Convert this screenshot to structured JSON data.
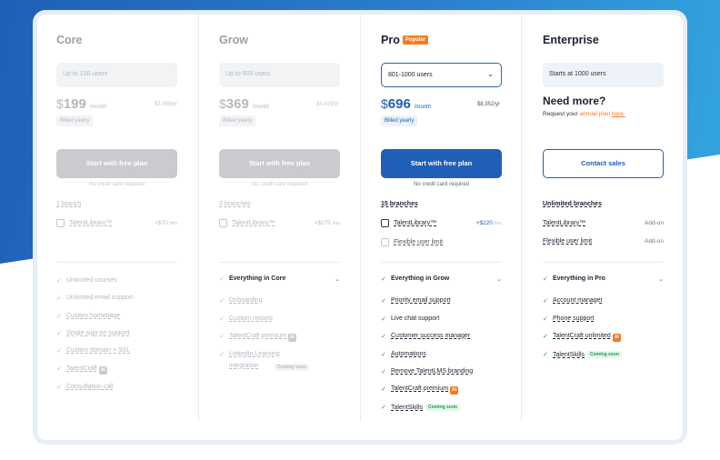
{
  "plans": [
    {
      "name": "Core",
      "users": "Up to 100 users",
      "currency": "$",
      "price": "199",
      "per": "/month",
      "yearly": "$2,388/yr",
      "billed": "Billed yearly",
      "cta": "Start with free plan",
      "no_cc": "No credit card required",
      "branches": "1 branch",
      "addons": [
        {
          "label": "TalentLibrary™",
          "price": "+$70",
          "unit": "/mo"
        }
      ],
      "features": [
        {
          "text": "Unlimited courses"
        },
        {
          "text": "Unlimited email support"
        },
        {
          "text": "Custom homepage"
        },
        {
          "text": "Single sign-on support"
        },
        {
          "text": "Custom domain + SSL"
        },
        {
          "text": "TalentCraft"
        },
        {
          "text": "Consultation call"
        }
      ]
    },
    {
      "name": "Grow",
      "users": "Up to 500 users",
      "currency": "$",
      "price": "369",
      "per": "/month",
      "yearly": "$4,428/yr",
      "billed": "Billed yearly",
      "cta": "Start with free plan",
      "no_cc": "No credit card required",
      "branches": "3 branches",
      "addons": [
        {
          "label": "TalentLibrary™",
          "price": "+$175",
          "unit": "/mo"
        }
      ],
      "features": [
        {
          "text": "Everything in Core"
        },
        {
          "text": "Onboarding"
        },
        {
          "text": "Custom reports"
        },
        {
          "text": "TalentCraft premium"
        },
        {
          "text": "LinkedIn Learning"
        },
        {
          "text": "integration",
          "tag": "Coming soon"
        }
      ]
    },
    {
      "name": "Pro",
      "badge": "Popular",
      "users": "801-1000 users",
      "currency": "$",
      "price": "696",
      "per": "/month",
      "yearly": "$8,352/yr",
      "billed": "Billed yearly",
      "cta": "Start with free plan",
      "no_cc": "No credit card required",
      "branches": "15 branches",
      "addons": [
        {
          "label": "TalentLibrary™",
          "price": "+$220",
          "unit": "/mo"
        },
        {
          "label": "Flexible user limit"
        }
      ],
      "features": [
        {
          "text": "Everything in Grow"
        },
        {
          "text": "Priority email support"
        },
        {
          "text": "Live chat support"
        },
        {
          "text": "Customer success manager"
        },
        {
          "text": "Automations"
        },
        {
          "text": "Remove TalentLMS branding"
        },
        {
          "text": "TalentCraft premium"
        },
        {
          "text": "TalentSkills",
          "tag": "Coming soon"
        }
      ]
    },
    {
      "name": "Enterprise",
      "users": "Starts at 1000 users",
      "need_more": "Need more?",
      "request_pre": "Request your ",
      "request_link": "annual plan",
      "request_here": "here.",
      "cta": "Contact sales",
      "branches": "Unlimited branches",
      "addons": [
        {
          "label": "TalentLibrary™",
          "price": "Add-on"
        },
        {
          "label": "Flexible user limit",
          "price": "Add-on"
        }
      ],
      "features": [
        {
          "text": "Everything in Pro"
        },
        {
          "text": "Account manager"
        },
        {
          "text": "Phone support"
        },
        {
          "text": "TalentCraft unlimited"
        },
        {
          "text": "TalentSkills",
          "tag": "Coming soon"
        }
      ]
    }
  ],
  "ai_label": "AI",
  "check_glyph": "✓",
  "chevron_glyph": "⌄",
  "colors": {
    "accent": "#1f5fb8",
    "popular": "#f47b20",
    "success": "#1a9a55"
  }
}
